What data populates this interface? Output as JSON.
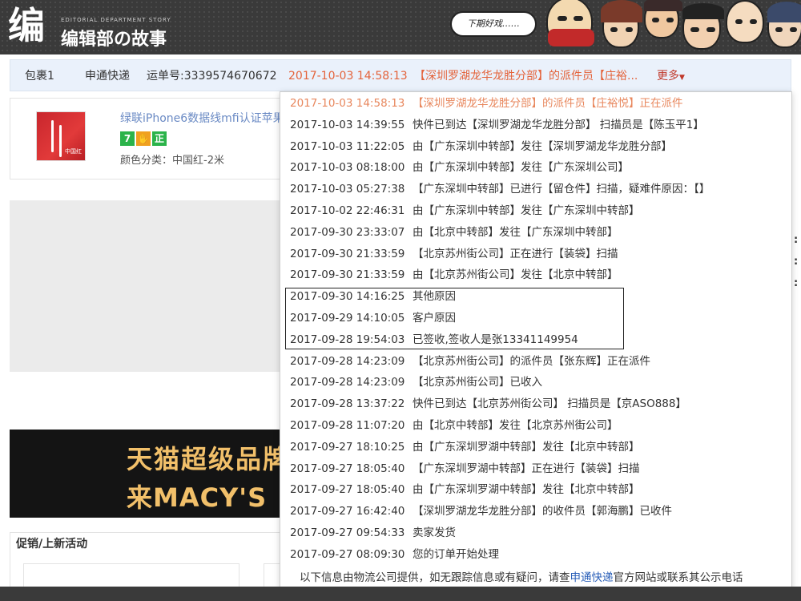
{
  "banner": {
    "logo_mark": "编",
    "logo_sub": "EDITORIAL DEPARTMENT STORY",
    "logo_title": "编辑部の故事",
    "speech_text": "下期好戏……"
  },
  "package_bar": {
    "package_label": "包裹1",
    "courier": "申通快递",
    "tracking_no": "运单号:3339574670672",
    "latest_time": "2017-10-03 14:58:13",
    "latest_status": "【深圳罗湖龙华龙胜分部】的派件员【庄裕...",
    "more_label": "更多",
    "more_icon": "chevron-down-icon"
  },
  "product": {
    "title": "绿联iPhone6数据线mfi认证苹果",
    "badges": [
      {
        "text": "7",
        "color": "#2bb34a"
      },
      {
        "text": "✋",
        "color": "#f0a020"
      },
      {
        "text": "正",
        "color": "#2bb34a"
      }
    ],
    "color_label": "颜色分类：中国红-2米",
    "thumb_tag": "中国红"
  },
  "ad": {
    "line1": "天猫超级品牌日 ×",
    "line2": "来MACY'S"
  },
  "promo": {
    "title": "促销/上新活动"
  },
  "side_markers": [
    ":",
    ":",
    ":"
  ],
  "tracking": [
    {
      "time": "2017-10-03 14:58:13",
      "text": "【深圳罗湖龙华龙胜分部】的派件员【庄裕悦】正在派件"
    },
    {
      "time": "2017-10-03 14:39:55",
      "text": "快件已到达【深圳罗湖龙华龙胜分部】 扫描员是【陈玉平1】"
    },
    {
      "time": "2017-10-03 11:22:05",
      "text": "由【广东深圳中转部】发往【深圳罗湖龙华龙胜分部】"
    },
    {
      "time": "2017-10-03 08:18:00",
      "text": "由【广东深圳中转部】发往【广东深圳公司】"
    },
    {
      "time": "2017-10-03 05:27:38",
      "text": "【广东深圳中转部】已进行【留仓件】扫描，疑难件原因：【】"
    },
    {
      "time": "2017-10-02 22:46:31",
      "text": "由【广东深圳中转部】发往【广东深圳中转部】"
    },
    {
      "time": "2017-09-30 23:33:07",
      "text": "由【北京中转部】发往【广东深圳中转部】"
    },
    {
      "time": "2017-09-30 21:33:59",
      "text": "【北京苏州街公司】正在进行【装袋】扫描"
    },
    {
      "time": "2017-09-30 21:33:59",
      "text": "由【北京苏州街公司】发往【北京中转部】"
    },
    {
      "time": "2017-09-30 14:16:25",
      "text": "其他原因"
    },
    {
      "time": "2017-09-29 14:10:05",
      "text": "客户原因"
    },
    {
      "time": "2017-09-28 19:54:03",
      "text": "已签收,签收人是张13341149954"
    },
    {
      "time": "2017-09-28 14:23:09",
      "text": "【北京苏州街公司】的派件员【张东辉】正在派件"
    },
    {
      "time": "2017-09-28 14:23:09",
      "text": "【北京苏州街公司】已收入"
    },
    {
      "time": "2017-09-28 13:37:22",
      "text": "快件已到达【北京苏州街公司】 扫描员是【京ASO888】"
    },
    {
      "time": "2017-09-28 11:07:20",
      "text": "由【北京中转部】发往【北京苏州街公司】"
    },
    {
      "time": "2017-09-27 18:10:25",
      "text": "由【广东深圳罗湖中转部】发往【北京中转部】"
    },
    {
      "time": "2017-09-27 18:05:40",
      "text": "【广东深圳罗湖中转部】正在进行【装袋】扫描"
    },
    {
      "time": "2017-09-27 18:05:40",
      "text": "由【广东深圳罗湖中转部】发往【北京中转部】"
    },
    {
      "time": "2017-09-27 16:42:40",
      "text": "【深圳罗湖龙华龙胜分部】的收件员【郭海鹏】已收件"
    },
    {
      "time": "2017-09-27 09:54:33",
      "text": "卖家发货"
    },
    {
      "time": "2017-09-27 08:09:30",
      "text": "您的订单开始处理"
    }
  ],
  "footnote": {
    "prefix": "以下信息由物流公司提供，如无跟踪信息或有疑问，请查",
    "link": "申通快递",
    "suffix": "官方网站或联系其公示电话"
  },
  "colors": {
    "accent_orange": "#e4633b",
    "first_row_orange": "#e8875d",
    "link_blue": "#2a5fb8",
    "bar_bg": "#eaf1fb"
  }
}
